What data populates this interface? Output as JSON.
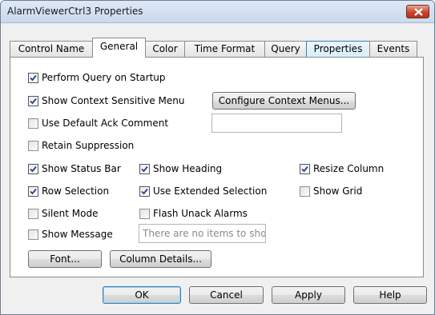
{
  "window": {
    "title": "AlarmViewerCtrl3 Properties"
  },
  "tabs": [
    {
      "label": "Control Name"
    },
    {
      "label": "General"
    },
    {
      "label": "Color"
    },
    {
      "label": "Time Format"
    },
    {
      "label": "Query"
    },
    {
      "label": "Properties"
    },
    {
      "label": "Events"
    }
  ],
  "general": {
    "perform_query": {
      "label": "Perform Query on Startup",
      "checked": true
    },
    "show_context_menu": {
      "label": "Show Context Sensitive Menu",
      "checked": true
    },
    "configure_context_menus_label": "Configure Context Menus...",
    "use_default_ack": {
      "label": "Use Default Ack Comment",
      "checked": false
    },
    "ack_comment_value": "",
    "retain_suppression": {
      "label": "Retain Suppression",
      "checked": false
    },
    "show_status_bar": {
      "label": "Show Status Bar",
      "checked": true
    },
    "show_heading": {
      "label": "Show Heading",
      "checked": true
    },
    "resize_column": {
      "label": "Resize Column",
      "checked": true
    },
    "row_selection": {
      "label": "Row Selection",
      "checked": true
    },
    "use_extended_selection": {
      "label": "Use Extended Selection",
      "checked": true
    },
    "show_grid": {
      "label": "Show Grid",
      "checked": false
    },
    "silent_mode": {
      "label": "Silent Mode",
      "checked": false
    },
    "flash_unack_alarms": {
      "label": "Flash Unack Alarms",
      "checked": false
    },
    "show_message": {
      "label": "Show Message",
      "checked": false
    },
    "message_text": "There are no items to sho",
    "font_button_label": "Font...",
    "column_details_label": "Column Details..."
  },
  "footer": {
    "ok_label": "OK",
    "cancel_label": "Cancel",
    "apply_label": "Apply",
    "help_label": "Help"
  }
}
